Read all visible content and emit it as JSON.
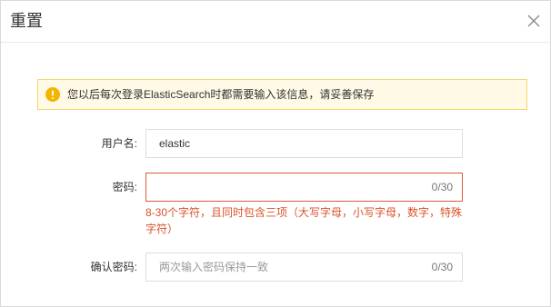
{
  "dialog": {
    "title": "重置",
    "close_icon": "close-icon"
  },
  "alert": {
    "icon": "warning-icon",
    "text": "您以后每次登录ElasticSearch时都需要输入该信息，请妥善保存",
    "bg_color": "#fff9e6",
    "border_color": "#f5d76e",
    "icon_color": "#f2b600"
  },
  "form": {
    "username": {
      "label": "用户名:",
      "value": "elastic"
    },
    "password": {
      "label": "密码:",
      "value": "",
      "counter": "0/30",
      "error": "8-30个字符，且同时包含三项（大写字母，小写字母，数字，特殊字符）"
    },
    "confirm": {
      "label": "确认密码:",
      "placeholder": "两次输入密码保持一致",
      "counter": "0/30"
    }
  },
  "colors": {
    "error": "#d95b3a",
    "border": "#dcdcdc"
  }
}
